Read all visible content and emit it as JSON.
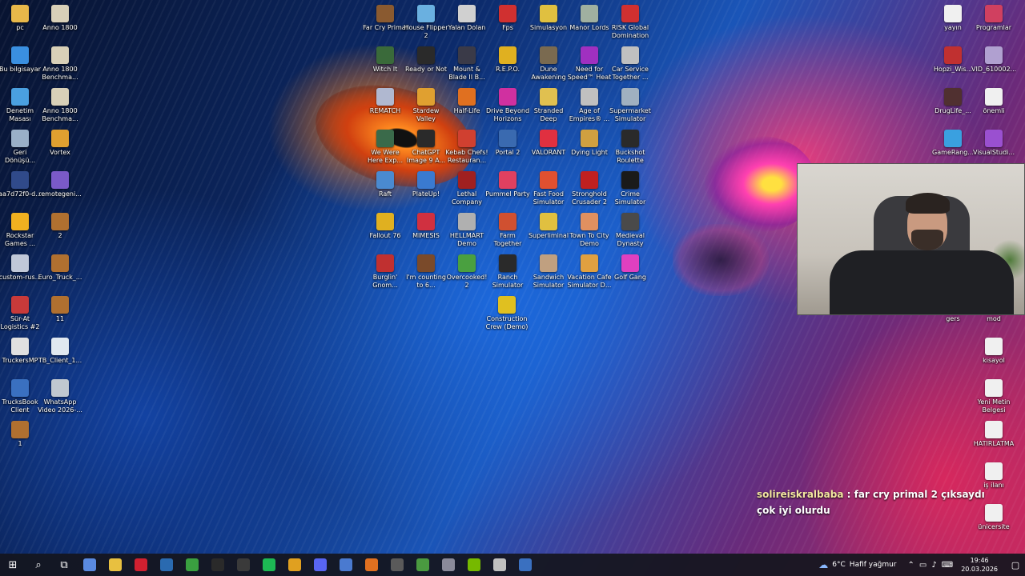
{
  "desktop": {
    "icons_left": [
      {
        "label": "pc",
        "icon": "folder-icon",
        "color": "#e8b84a"
      },
      {
        "label": "Anno 1800",
        "icon": "game-icon",
        "color": "#d8d0b8"
      },
      {
        "label": "Bu bilgisayar",
        "icon": "computer-icon",
        "color": "#3a8fe0"
      },
      {
        "label": "Anno 1800 Benchma...",
        "icon": "game-icon",
        "color": "#d8d0b8"
      },
      {
        "label": "Denetim Masası",
        "icon": "control-panel-icon",
        "color": "#4aa0e0"
      },
      {
        "label": "Anno 1800 Benchma...",
        "icon": "game-icon",
        "color": "#d8d0b8"
      },
      {
        "label": "Geri Dönüşü...",
        "icon": "recycle-bin-icon",
        "color": "#9ab0c8"
      },
      {
        "label": "Vortex",
        "icon": "vortex-icon",
        "color": "#e0a030"
      },
      {
        "label": "aa7d72f0-d...",
        "icon": "image-icon",
        "color": "#304a8a"
      },
      {
        "label": "remotegeni...",
        "icon": "app-icon",
        "color": "#7a5ac8"
      },
      {
        "label": "Rockstar Games ...",
        "icon": "rockstar-icon",
        "color": "#f0b020"
      },
      {
        "label": "2",
        "icon": "truck-icon",
        "color": "#b07030"
      },
      {
        "label": "custom-rus...",
        "icon": "image-icon",
        "color": "#c0c8d8"
      },
      {
        "label": "Euro_Truck_...",
        "icon": "truck-icon",
        "color": "#b07030"
      },
      {
        "label": "Sür-At Logistics #2",
        "icon": "archive-icon",
        "color": "#c83a3a"
      },
      {
        "label": "11",
        "icon": "truck-icon",
        "color": "#b07030"
      },
      {
        "label": "TruckersMP",
        "icon": "truck-icon",
        "color": "#e0e0e0"
      },
      {
        "label": "TB_Client_1...",
        "icon": "file-icon",
        "color": "#e0e8f0"
      },
      {
        "label": "TrucksBook Client",
        "icon": "trucksbook-icon",
        "color": "#3a70c0"
      },
      {
        "label": "WhatsApp Video 2026-...",
        "icon": "video-icon",
        "color": "#c0c8d0"
      },
      {
        "label": "1",
        "icon": "truck-icon",
        "color": "#b07030"
      }
    ],
    "icons_center": [
      {
        "label": "Far Cry Primal",
        "icon": "farcry-icon",
        "color": "#8a5a30"
      },
      {
        "label": "House Flipper 2",
        "icon": "game-icon",
        "color": "#6ab0e0"
      },
      {
        "label": "Yalan Dolan",
        "icon": "game-icon",
        "color": "#d0d0d0"
      },
      {
        "label": "Fps",
        "icon": "game-icon",
        "color": "#d03030"
      },
      {
        "label": "Simulasyon",
        "icon": "folder-icon",
        "color": "#e0c040"
      },
      {
        "label": "Manor Lords",
        "icon": "game-icon",
        "color": "#a0b0a0"
      },
      {
        "label": "RISK Global Domination",
        "icon": "game-icon",
        "color": "#d03030"
      },
      {
        "label": "Witch It",
        "icon": "game-icon",
        "color": "#3a6a3a"
      },
      {
        "label": "Ready or Not",
        "icon": "game-icon",
        "color": "#2a2a2a"
      },
      {
        "label": "Mount & Blade II B...",
        "icon": "game-icon",
        "color": "#3a3a48"
      },
      {
        "label": "R.E.P.O.",
        "icon": "game-icon",
        "color": "#e0b020"
      },
      {
        "label": "Dune Awakening",
        "icon": "game-icon",
        "color": "#7a6a50"
      },
      {
        "label": "Need for Speed™ Heat",
        "icon": "game-icon",
        "color": "#a030c0"
      },
      {
        "label": "Car Service Together ...",
        "icon": "game-icon",
        "color": "#c0c0c0"
      },
      {
        "label": "REMATCH",
        "icon": "game-icon",
        "color": "#b0b8d0"
      },
      {
        "label": "Stardew Valley",
        "icon": "game-icon",
        "color": "#e0a030"
      },
      {
        "label": "Half-Life",
        "icon": "halflife-icon",
        "color": "#e07020"
      },
      {
        "label": "Drive Beyond Horizons",
        "icon": "game-icon",
        "color": "#d030a0"
      },
      {
        "label": "Stranded Deep",
        "icon": "game-icon",
        "color": "#e0c050"
      },
      {
        "label": "Age of Empires® ...",
        "icon": "game-icon",
        "color": "#c0c0c0"
      },
      {
        "label": "Supermarket Simulator",
        "icon": "game-icon",
        "color": "#a0b0c0"
      },
      {
        "label": "We Were Here Exp...",
        "icon": "game-icon",
        "color": "#3a6a4a"
      },
      {
        "label": "ChatGPT Image 9 A...",
        "icon": "image-icon",
        "color": "#2a2a2a"
      },
      {
        "label": "Kebab Chefs! Restauran...",
        "icon": "game-icon",
        "color": "#d04030"
      },
      {
        "label": "Portal 2",
        "icon": "game-icon",
        "color": "#3a6ab0"
      },
      {
        "label": "VALORANT",
        "icon": "valorant-icon",
        "color": "#e03040"
      },
      {
        "label": "Dying Light",
        "icon": "game-icon",
        "color": "#d0a040"
      },
      {
        "label": "Buckshot Roulette",
        "icon": "game-icon",
        "color": "#2a2a2a"
      },
      {
        "label": "Raft",
        "icon": "game-icon",
        "color": "#4a8ad0"
      },
      {
        "label": "PlateUp!",
        "icon": "game-icon",
        "color": "#3a7ad0"
      },
      {
        "label": "Lethal Company",
        "icon": "game-icon",
        "color": "#a02020"
      },
      {
        "label": "Pummel Party",
        "icon": "game-icon",
        "color": "#e04060"
      },
      {
        "label": "Fast Food Simulator",
        "icon": "game-icon",
        "color": "#e05030"
      },
      {
        "label": "Stronghold Crusader 2",
        "icon": "game-icon",
        "color": "#c02020"
      },
      {
        "label": "Crime Simulator",
        "icon": "game-icon",
        "color": "#1a1a1a"
      },
      {
        "label": "Fallout 76",
        "icon": "game-icon",
        "color": "#e0b020"
      },
      {
        "label": "MIMESIS",
        "icon": "game-icon",
        "color": "#d03040"
      },
      {
        "label": "HELLMART Demo",
        "icon": "game-icon",
        "color": "#b0b0b0"
      },
      {
        "label": "Farm Together",
        "icon": "game-icon",
        "color": "#d05030"
      },
      {
        "label": "Superliminal",
        "icon": "game-icon",
        "color": "#e0c040"
      },
      {
        "label": "Town To City Demo",
        "icon": "game-icon",
        "color": "#e09060"
      },
      {
        "label": "Medieval Dynasty",
        "icon": "game-icon",
        "color": "#4a4a4a"
      },
      {
        "label": "Burglin' Gnom...",
        "icon": "game-icon",
        "color": "#c03030"
      },
      {
        "label": "I'm counting to 6...",
        "icon": "game-icon",
        "color": "#7a4a2a"
      },
      {
        "label": "Overcooked! 2",
        "icon": "game-icon",
        "color": "#4aa040"
      },
      {
        "label": "Ranch Simulator",
        "icon": "game-icon",
        "color": "#2a2a2a"
      },
      {
        "label": "Sandwich Simulator",
        "icon": "game-icon",
        "color": "#c0a080"
      },
      {
        "label": "Vacation Cafe Simulator D...",
        "icon": "game-icon",
        "color": "#e0a040"
      },
      {
        "label": "Golf Gang",
        "icon": "game-icon",
        "color": "#e040c0"
      },
      {
        "label": "Construction Crew (Demo)",
        "icon": "game-icon",
        "color": "#e0c020"
      }
    ],
    "icons_right": [
      {
        "label": "yayın",
        "icon": "file-icon",
        "color": "#f0f0f0"
      },
      {
        "label": "Programlar",
        "icon": "folder-icon",
        "color": "#d04060"
      },
      {
        "label": "Hopzi_Wis...",
        "icon": "image-icon",
        "color": "#c03030"
      },
      {
        "label": "VID_610002...",
        "icon": "video-icon",
        "color": "#b0a0d0"
      },
      {
        "label": "DrugLife_...",
        "icon": "image-icon",
        "color": "#503030"
      },
      {
        "label": "önemli",
        "icon": "file-icon",
        "color": "#f0f0f0"
      },
      {
        "label": "GameRang...",
        "icon": "gameranger-icon",
        "color": "#3aa0e0"
      },
      {
        "label": "VisualStudi...",
        "icon": "visual-studio-icon",
        "color": "#9a50d0"
      },
      {
        "label": "gers",
        "icon": "file-icon",
        "color": "#f0f0f0"
      },
      {
        "label": "mod",
        "icon": "file-icon",
        "color": "#f0f0f0"
      },
      {
        "label": "kısayol",
        "icon": "file-icon",
        "color": "#f0f0f0"
      },
      {
        "label": "Yeni Metin Belgesi",
        "icon": "file-icon",
        "color": "#f0f0f0"
      },
      {
        "label": "HATIRLATMA",
        "icon": "file-icon",
        "color": "#f0f0f0"
      },
      {
        "label": "iş ilanı",
        "icon": "file-icon",
        "color": "#f0f0f0"
      },
      {
        "label": "ünicersite",
        "icon": "file-icon",
        "color": "#f0f0f0"
      }
    ]
  },
  "chat": {
    "username": "solireiskralbaba",
    "separator": ":",
    "message": "far cry primal 2 çıksaydı çok iyi olurdu"
  },
  "taskbar": {
    "start": "⊞",
    "search": "⌕",
    "task_view": "⧉",
    "apps": [
      {
        "name": "copilot-app",
        "color": "#5a8ae0"
      },
      {
        "name": "file-explorer-app",
        "color": "#e8c040"
      },
      {
        "name": "opera-app",
        "color": "#d02030"
      },
      {
        "name": "steam-app",
        "color": "#2a6ab0"
      },
      {
        "name": "xbox-app",
        "color": "#3aa040"
      },
      {
        "name": "epic-games-app",
        "color": "#2a2a2a"
      },
      {
        "name": "obs-app",
        "color": "#3a3a3a"
      },
      {
        "name": "spotify-app",
        "color": "#1db954"
      },
      {
        "name": "chrome-app",
        "color": "#e0a020"
      },
      {
        "name": "discord-app",
        "color": "#5865f2"
      },
      {
        "name": "app-blue-circle",
        "color": "#4a7ad0"
      },
      {
        "name": "blender-app",
        "color": "#e07020"
      },
      {
        "name": "app-gauge",
        "color": "#5a5a5a"
      },
      {
        "name": "app-green-cube",
        "color": "#4a9a40"
      },
      {
        "name": "app-settings",
        "color": "#8a8a9a"
      },
      {
        "name": "nvidia-app",
        "color": "#76b900"
      },
      {
        "name": "truckersmp-app",
        "color": "#c0c0c0"
      },
      {
        "name": "trucksbook-app",
        "color": "#3a70c0"
      }
    ],
    "weather_temp": "6°C",
    "weather_desc": "Hafif yağmur",
    "time": "19:46",
    "date": "20.03.2026"
  }
}
